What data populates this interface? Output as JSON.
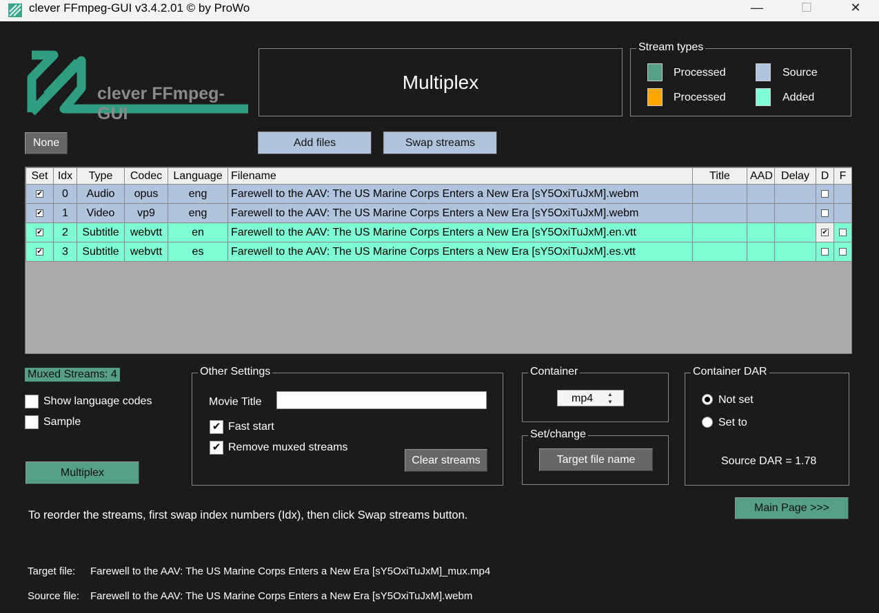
{
  "window": {
    "title": "clever FFmpeg-GUI v3.4.2.01   © by ProWo",
    "minimize": "—",
    "maximize": "☐",
    "close": "✕"
  },
  "logo": {
    "text": "clever FFmpeg-GUI"
  },
  "header": {
    "title": "Multiplex"
  },
  "stream_types": {
    "title": "Stream types",
    "items": [
      {
        "label": "Processed",
        "color": "#559f85"
      },
      {
        "label": "Source",
        "color": "#b0c4de"
      },
      {
        "label": "Processed",
        "color": "#ffa500"
      },
      {
        "label": "Added",
        "color": "#7fffd4"
      }
    ]
  },
  "buttons": {
    "none": "None",
    "add_files": "Add files",
    "swap_streams": "Swap streams",
    "multiplex": "Multiplex",
    "clear_streams": "Clear streams",
    "target_file_name": "Target file name",
    "main_page": "Main Page >>>"
  },
  "table": {
    "columns": [
      "Set",
      "Idx",
      "Type",
      "Codec",
      "Language",
      "Filename",
      "Title",
      "AAD",
      "Delay",
      "D",
      "F"
    ],
    "rows": [
      {
        "set": true,
        "idx": "0",
        "type": "Audio",
        "codec": "opus",
        "language": "eng",
        "filename": "Farewell to the AAV: The US Marine Corps Enters a New Era [sY5OxiTuJxM].webm",
        "title": "",
        "aad": "",
        "delay": "",
        "d": false,
        "f": null,
        "color": "#b0c4de"
      },
      {
        "set": true,
        "idx": "1",
        "type": "Video",
        "codec": "vp9",
        "language": "eng",
        "filename": "Farewell to the AAV: The US Marine Corps Enters a New Era [sY5OxiTuJxM].webm",
        "title": "",
        "aad": "",
        "delay": "",
        "d": false,
        "f": null,
        "color": "#b0c4de"
      },
      {
        "set": true,
        "idx": "2",
        "type": "Subtitle",
        "codec": "webvtt",
        "language": "en",
        "filename": "Farewell to the AAV: The US Marine Corps Enters a New Era [sY5OxiTuJxM].en.vtt",
        "title": "",
        "aad": "",
        "delay": "",
        "d": true,
        "f": false,
        "color": "#7fffd4"
      },
      {
        "set": true,
        "idx": "3",
        "type": "Subtitle",
        "codec": "webvtt",
        "language": "es",
        "filename": "Farewell to the AAV: The US Marine Corps Enters a New Era [sY5OxiTuJxM].es.vtt",
        "title": "",
        "aad": "",
        "delay": "",
        "d": false,
        "f": false,
        "color": "#7fffd4"
      }
    ]
  },
  "muxed": {
    "label": "Muxed Streams:  4"
  },
  "options": {
    "show_language_codes": "Show language codes",
    "sample": "Sample"
  },
  "other_settings": {
    "title": "Other Settings",
    "movie_title_label": "Movie Title",
    "movie_title_value": "",
    "fast_start": "Fast start",
    "remove_muxed": "Remove muxed streams"
  },
  "container": {
    "title": "Container",
    "value": "mp4"
  },
  "set_change": {
    "title": "Set/change"
  },
  "dar": {
    "title": "Container DAR",
    "not_set": "Not set",
    "set_to": "Set to",
    "source_dar": "Source DAR = 1.78"
  },
  "hint": "To reorder the streams, first swap index numbers (Idx), then click Swap streams button.",
  "files": {
    "target_label": "Target file:",
    "target": "Farewell to the AAV: The US Marine Corps Enters a New Era [sY5OxiTuJxM]_mux.mp4",
    "source_label": "Source file:",
    "source": "Farewell to the AAV: The US Marine Corps Enters a New Era [sY5OxiTuJxM].webm"
  }
}
